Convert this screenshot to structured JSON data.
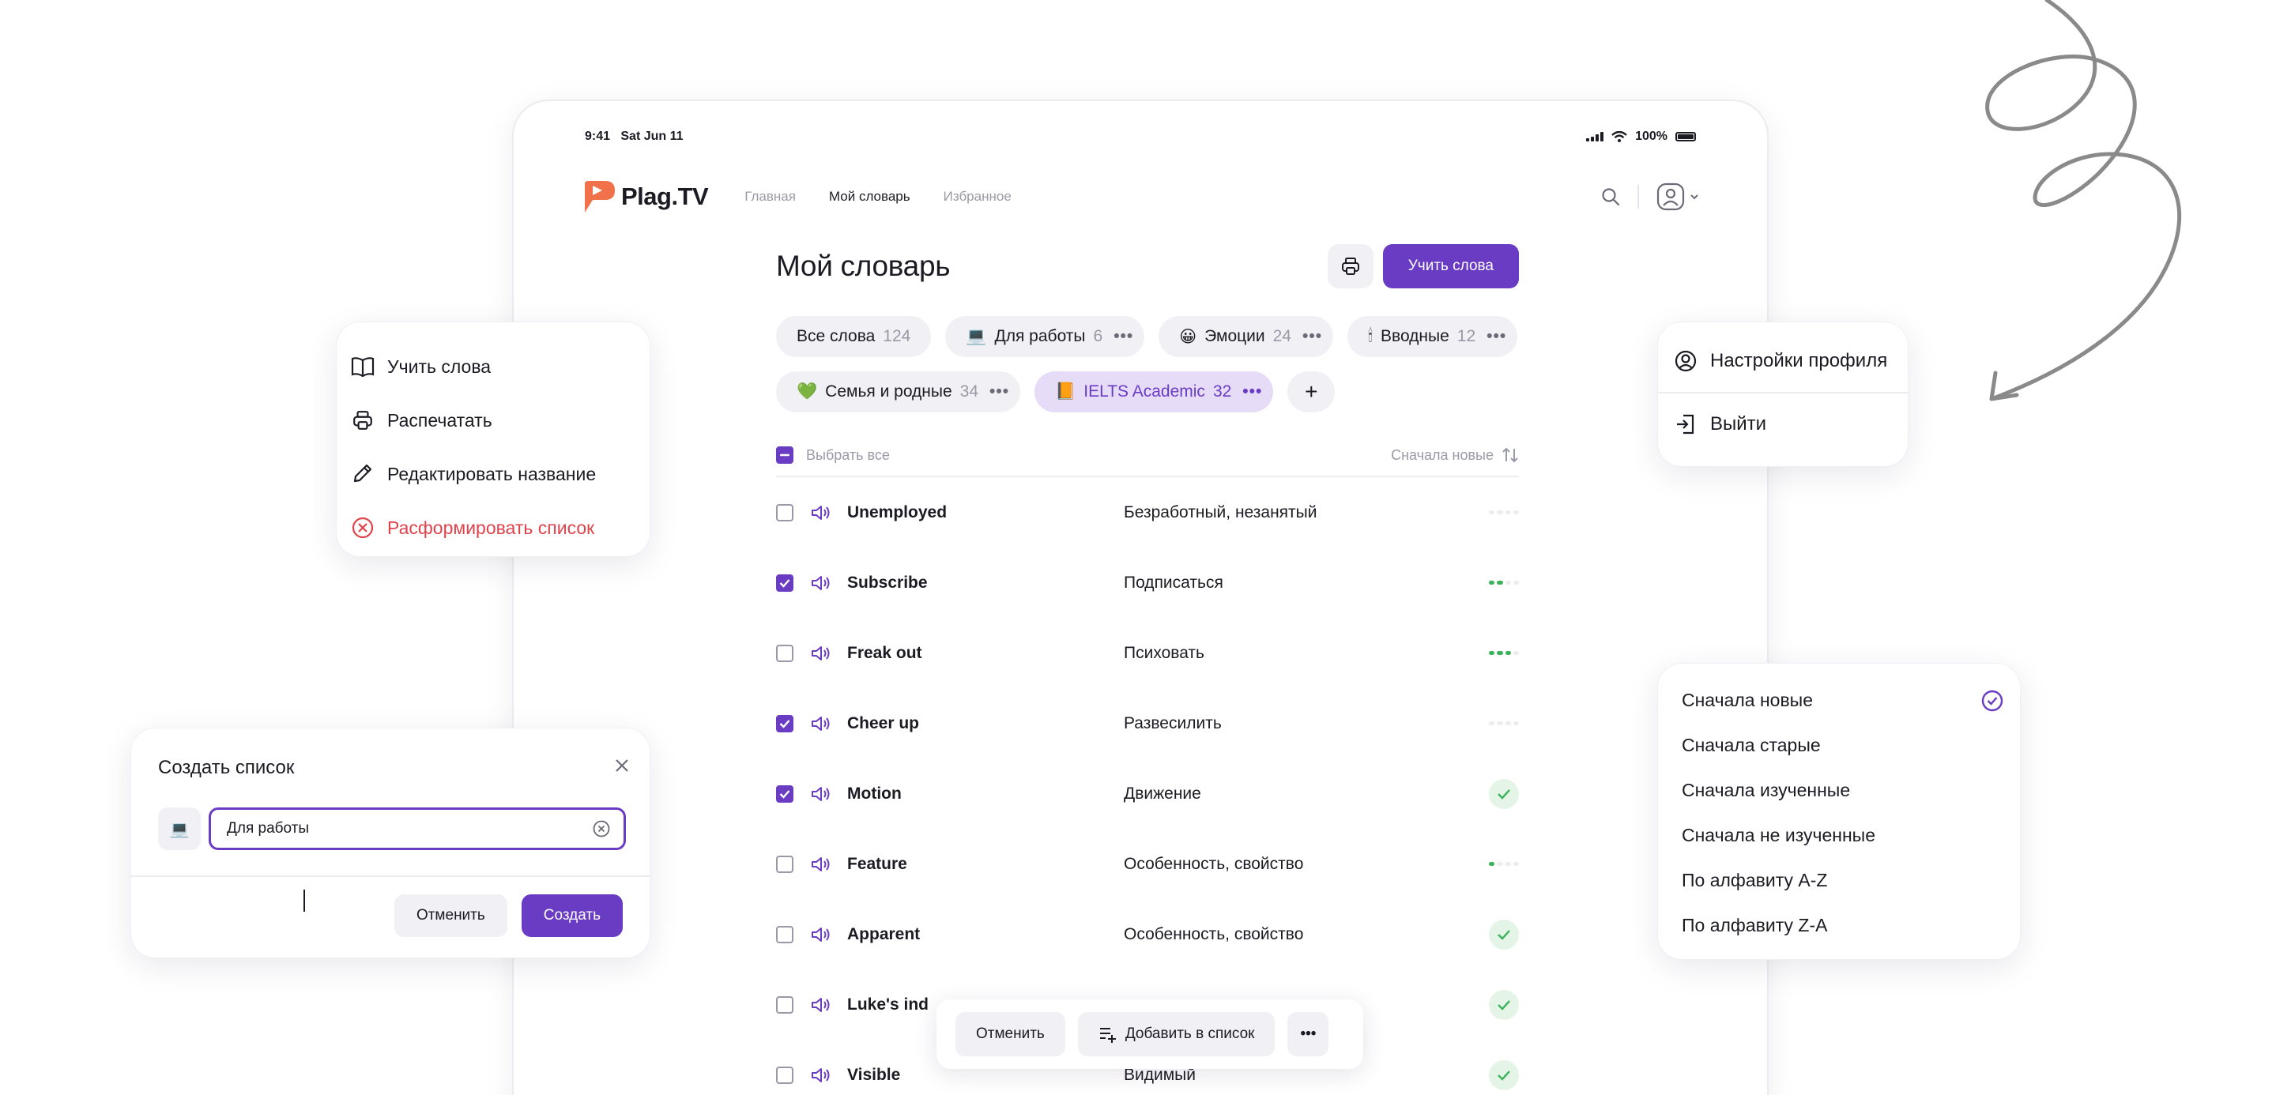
{
  "status_bar": {
    "time": "9:41",
    "date": "Sat Jun 11",
    "battery": "100%"
  },
  "app": {
    "logo": "Plag.TV",
    "nav": [
      "Главная",
      "Мой словарь",
      "Избранное"
    ],
    "active_nav": "Мой словарь"
  },
  "page": {
    "title": "Мой словарь",
    "learn_button": "Учить слова"
  },
  "chips": [
    {
      "emoji": "",
      "label": "Все слова",
      "count": "124"
    },
    {
      "emoji": "💻",
      "label": "Для работы",
      "count": "6"
    },
    {
      "emoji": "😀",
      "label": "Эмоции",
      "count": "24"
    },
    {
      "emoji": "🕯",
      "label": "Вводные",
      "count": "12"
    },
    {
      "emoji": "💚",
      "label": "Семья и родные",
      "count": "34"
    },
    {
      "emoji": "📙",
      "label": "IELTS Academic",
      "count": "32",
      "selected": true
    }
  ],
  "list_header": {
    "select_all": "Выбрать все",
    "sort": "Сначала новые"
  },
  "words": [
    {
      "en": "Unemployed",
      "ru": "Безработный, незанятый",
      "checked": false,
      "progress": 0
    },
    {
      "en": "Subscribe",
      "ru": "Подписаться",
      "checked": true,
      "progress": 2
    },
    {
      "en": "Freak out",
      "ru": "Психовать",
      "checked": false,
      "progress": 3
    },
    {
      "en": "Cheer up",
      "ru": "Развесилить",
      "checked": true,
      "progress": 0
    },
    {
      "en": "Motion",
      "ru": "Движение",
      "checked": true,
      "progress": "done"
    },
    {
      "en": "Feature",
      "ru": "Особенность, свойство",
      "checked": false,
      "progress": 1
    },
    {
      "en": "Apparent",
      "ru": "Особенность, свойство",
      "checked": false,
      "progress": "done"
    },
    {
      "en": "Luke's ind",
      "ru": "",
      "checked": false,
      "progress": "done"
    },
    {
      "en": "Visible",
      "ru": "Видимый",
      "checked": false,
      "progress": "done"
    }
  ],
  "action_bar": {
    "cancel": "Отменить",
    "add_to_list": "Добавить в список"
  },
  "context_menu": {
    "learn": "Учить слова",
    "print": "Распечатать",
    "rename": "Редактировать название",
    "disband": "Расформировать список"
  },
  "profile_menu": {
    "settings": "Настройки профиля",
    "logout": "Выйти"
  },
  "sort_menu": {
    "options": [
      "Сначала новые",
      "Сначала старые",
      "Сначала изученные",
      "Сначала не изученные",
      "По алфавиту A-Z",
      "По алфавиту Z-A"
    ],
    "selected": "Сначала новые"
  },
  "create_dialog": {
    "title": "Создать список",
    "emoji": "💻",
    "value": "Для работы",
    "cancel": "Отменить",
    "create": "Создать"
  },
  "colors": {
    "accent": "#6a3cc4",
    "danger": "#e0434b",
    "success": "#3ab25a",
    "logo": "#f0714a"
  }
}
